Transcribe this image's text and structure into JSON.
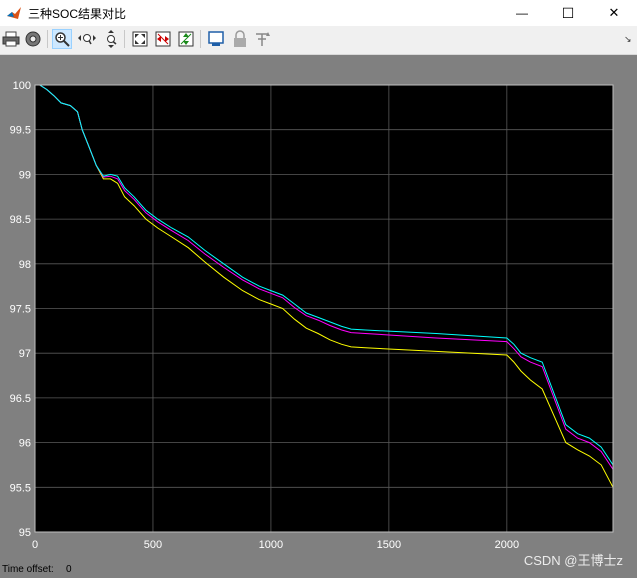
{
  "window": {
    "title": "三种SOC结果对比",
    "minimize_glyph": "—",
    "maximize_glyph": "☐",
    "close_glyph": "✕"
  },
  "toolbar": {
    "items": [
      "print-icon",
      "settings-icon",
      "zoom-in-icon",
      "zoom-x-icon",
      "zoom-y-icon",
      "fit-to-view-icon",
      "fit-x-icon",
      "fit-y-icon",
      "highlight-block-icon",
      "lock-icon",
      "signal-select-icon"
    ],
    "dock_glyph": "↘"
  },
  "status": {
    "time_offset_label": "Time offset:",
    "time_offset_value": "0"
  },
  "watermark": "CSDN @王博士z",
  "chart_data": {
    "type": "line",
    "title": "",
    "xlabel": "",
    "ylabel": "",
    "xlim": [
      0,
      2450
    ],
    "ylim": [
      95,
      100
    ],
    "xticks": [
      0,
      500,
      1000,
      1500,
      2000
    ],
    "yticks": [
      95,
      95.5,
      96,
      96.5,
      97,
      97.5,
      98,
      98.5,
      99,
      99.5,
      100
    ],
    "ytick_labels": [
      "95",
      "95.5",
      "96",
      "96.5",
      "97",
      "97.5",
      "98",
      "98.5",
      "99",
      "99.5",
      "100"
    ],
    "grid": true,
    "background": "#000000",
    "series": [
      {
        "color": "#00ffff",
        "x": [
          0,
          20,
          50,
          80,
          110,
          150,
          180,
          200,
          230,
          260,
          290,
          320,
          350,
          380,
          420,
          470,
          520,
          580,
          650,
          720,
          800,
          880,
          950,
          1000,
          1050,
          1100,
          1150,
          1200,
          1250,
          1300,
          1340,
          1400,
          1700,
          2000,
          2030,
          2060,
          2100,
          2150,
          2200,
          2250,
          2300,
          2350,
          2400,
          2450
        ],
        "y": [
          100,
          100,
          99.95,
          99.88,
          99.8,
          99.77,
          99.7,
          99.5,
          99.3,
          99.1,
          98.98,
          99.0,
          98.98,
          98.85,
          98.75,
          98.6,
          98.5,
          98.4,
          98.3,
          98.15,
          98.0,
          97.85,
          97.75,
          97.7,
          97.65,
          97.55,
          97.45,
          97.4,
          97.35,
          97.3,
          97.27,
          97.26,
          97.22,
          97.17,
          97.1,
          97.0,
          96.95,
          96.9,
          96.55,
          96.2,
          96.1,
          96.05,
          95.95,
          95.75
        ]
      },
      {
        "color": "#ff00ff",
        "x": [
          0,
          20,
          50,
          80,
          110,
          150,
          180,
          200,
          230,
          260,
          290,
          320,
          350,
          380,
          420,
          470,
          520,
          580,
          650,
          720,
          800,
          880,
          950,
          1000,
          1050,
          1100,
          1150,
          1200,
          1250,
          1300,
          1340,
          1400,
          1700,
          2000,
          2030,
          2060,
          2100,
          2150,
          2200,
          2250,
          2300,
          2350,
          2400,
          2450
        ],
        "y": [
          100,
          100,
          99.95,
          99.88,
          99.8,
          99.77,
          99.7,
          99.5,
          99.3,
          99.1,
          98.97,
          98.98,
          98.95,
          98.82,
          98.72,
          98.57,
          98.47,
          98.37,
          98.26,
          98.11,
          97.96,
          97.82,
          97.72,
          97.67,
          97.62,
          97.51,
          97.42,
          97.37,
          97.31,
          97.26,
          97.23,
          97.22,
          97.17,
          97.13,
          97.05,
          96.96,
          96.9,
          96.85,
          96.5,
          96.15,
          96.05,
          96.0,
          95.9,
          95.7
        ]
      },
      {
        "color": "#ffff00",
        "x": [
          0,
          20,
          50,
          80,
          110,
          150,
          180,
          200,
          230,
          260,
          290,
          320,
          350,
          380,
          420,
          470,
          520,
          580,
          650,
          720,
          800,
          880,
          950,
          1000,
          1050,
          1100,
          1150,
          1200,
          1250,
          1300,
          1340,
          1400,
          1700,
          2000,
          2030,
          2060,
          2100,
          2150,
          2200,
          2250,
          2300,
          2350,
          2400,
          2450
        ],
        "y": [
          100,
          100,
          99.95,
          99.88,
          99.8,
          99.77,
          99.7,
          99.5,
          99.3,
          99.1,
          98.95,
          98.95,
          98.9,
          98.75,
          98.65,
          98.5,
          98.4,
          98.3,
          98.18,
          98.02,
          97.85,
          97.7,
          97.6,
          97.55,
          97.5,
          97.38,
          97.28,
          97.22,
          97.15,
          97.1,
          97.07,
          97.06,
          97.02,
          96.98,
          96.9,
          96.8,
          96.7,
          96.6,
          96.3,
          96.0,
          95.92,
          95.85,
          95.75,
          95.5
        ]
      }
    ]
  }
}
